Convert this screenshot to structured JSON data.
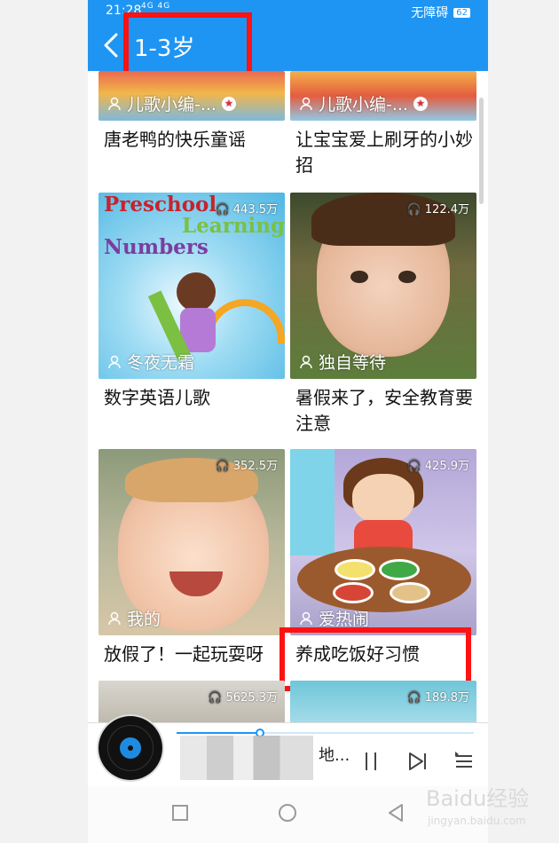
{
  "status_bar": {
    "time": "21:28",
    "signal_text": "4G 4G",
    "right_text": "无障碍",
    "battery": "62"
  },
  "header": {
    "title": "1-3岁",
    "bg_color": "#1f95f3"
  },
  "cards": [
    {
      "author": "儿歌小编-...",
      "verified": true,
      "title": "唐老鸭的快乐童谣",
      "plays": ""
    },
    {
      "author": "儿歌小编-...",
      "verified": true,
      "title": "让宝宝爱上刷牙的小妙招",
      "plays": ""
    },
    {
      "author": "冬夜无霜",
      "verified": false,
      "title": "数字英语儿歌",
      "plays": "443.5万",
      "art_line1": "Preschool",
      "art_line2": "Learning",
      "art_line3": "Numbers"
    },
    {
      "author": "独自等待",
      "verified": false,
      "title": "暑假来了，安全教育要注意",
      "plays": "122.4万"
    },
    {
      "author": "我的",
      "verified": false,
      "title": "放假了！一起玩耍呀",
      "plays": "352.5万"
    },
    {
      "author": "爱热闹",
      "verified": false,
      "title": "养成吃饭好习惯",
      "plays": "425.9万"
    },
    {
      "author": "",
      "verified": false,
      "title": "",
      "plays": "5625.3万"
    },
    {
      "author": "",
      "verified": false,
      "title": "",
      "plays": "189.8万"
    }
  ],
  "player": {
    "track": "地...",
    "progress": 0.28
  },
  "icons": {
    "back": "chevron-left-icon",
    "pause": "pause-icon",
    "next": "skip-next-icon",
    "playlist": "playlist-icon",
    "headphones": "headphones-icon",
    "user": "user-icon"
  },
  "watermark": {
    "brand": "Baidu经验",
    "url": "jingyan.baidu.com"
  }
}
